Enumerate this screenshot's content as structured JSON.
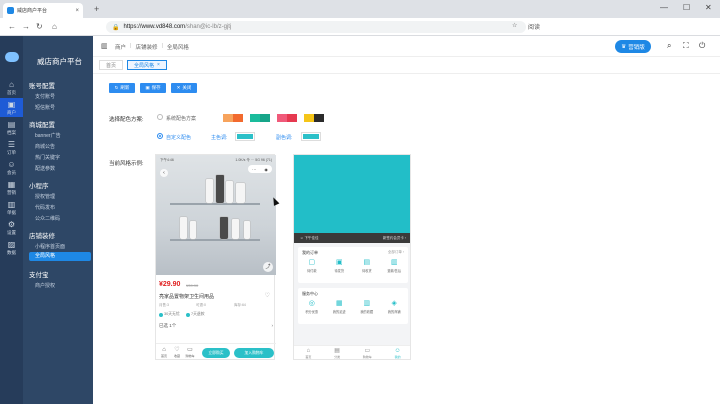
{
  "browser": {
    "tab_title": "威店商户平台",
    "tab_close": "×",
    "new_tab": "+",
    "url_host": "https://www.vd848.com",
    "url_path": "/shan@ic-lb/z-gjtj",
    "reading_mode": "阅读",
    "win_min": "—",
    "win_max": "☐",
    "win_close": "✕"
  },
  "sidebar": {
    "brand": "威店商户平台",
    "rail": [
      {
        "glyph": "⌂",
        "label": "首页"
      },
      {
        "glyph": "▣",
        "label": "商户"
      },
      {
        "glyph": "▤",
        "label": "档案"
      },
      {
        "glyph": "☰",
        "label": "订单"
      },
      {
        "glyph": "☺",
        "label": "会员"
      },
      {
        "glyph": "▦",
        "label": "营销"
      },
      {
        "glyph": "▥",
        "label": "单据"
      },
      {
        "glyph": "⚙",
        "label": "设置"
      },
      {
        "glyph": "▨",
        "label": "数据"
      }
    ],
    "groups": [
      {
        "title": "账号配置",
        "items": [
          "支付账号",
          "短信账号"
        ]
      },
      {
        "title": "商城配置",
        "items": [
          "banner广告",
          "商城公告",
          "热门关键字",
          "配送参数"
        ]
      },
      {
        "title": "小程序",
        "items": [
          "授权管理",
          "代码发布",
          "公众二维码"
        ]
      },
      {
        "title": "店铺装修",
        "items": [
          "小程序首页面",
          "全局风格"
        ]
      },
      {
        "title": "支付宝",
        "items": [
          "商户授权"
        ]
      }
    ]
  },
  "header": {
    "crumbs": [
      "商户",
      "店铺装修",
      "全局风格"
    ],
    "vip_label": "营销版"
  },
  "subtabs": [
    {
      "label": "首页",
      "active": false
    },
    {
      "label": "全局风格",
      "active": true
    }
  ],
  "toolbar": {
    "buttons": [
      "刷新",
      "保存",
      "关闭"
    ]
  },
  "form": {
    "scheme_label": "选择配色方案:",
    "system_scheme": "系统配色方案",
    "custom_scheme": "自定义配色",
    "main_color_label": "主色调:",
    "sub_color_label": "副色调:",
    "preview_label": "当前风格示例:",
    "swatches": [
      {
        "a": "#f7a35c",
        "b": "#f26a2e"
      },
      {
        "a": "#1abc9c",
        "b": "#17a589"
      },
      {
        "a": "#f05a7a",
        "b": "#e63950"
      },
      {
        "a": "#f5c518",
        "b": "#2b2b2b"
      }
    ],
    "main_color": "#2bc0c8",
    "sub_color": "#2bc0c8"
  },
  "preview1": {
    "status_left": "下午4:46",
    "status_right": "1.0K/s 令 ⋯ 5G 96 (71)",
    "price": "¥29.90",
    "orig_price": "¥39.90",
    "name": "亮家品置物架卫生间用品",
    "meta": [
      "月售:3",
      "可退:0",
      "库存:64"
    ],
    "badges": [
      "30天无忧",
      "7天退款"
    ],
    "select_label": "已选  1个",
    "select_arrow": "›",
    "bar_items": [
      {
        "glyph": "⌂",
        "label": "首页"
      },
      {
        "glyph": "♡",
        "label": "收藏"
      },
      {
        "glyph": "▭",
        "label": "购物车"
      }
    ],
    "buy_now": "立即购买",
    "add_cart": "加入购物车"
  },
  "preview2": {
    "strip_left": "☺  下午佳佳",
    "strip_right": "新签约会员卡 ›",
    "orders_title": "我的订单",
    "orders_more": "全部订单 ›",
    "order_items": [
      {
        "glyph": "▢",
        "label": "待付款"
      },
      {
        "glyph": "▣",
        "label": "待发货"
      },
      {
        "glyph": "▤",
        "label": "待收货"
      },
      {
        "glyph": "▥",
        "label": "退款/售后"
      }
    ],
    "service_title": "服务中心",
    "service_items": [
      {
        "glyph": "◎",
        "label": "积分优惠"
      },
      {
        "glyph": "▦",
        "label": "我的足迹"
      },
      {
        "glyph": "▥",
        "label": "我的收藏"
      },
      {
        "glyph": "◈",
        "label": "我的商铺"
      }
    ],
    "tabs": [
      {
        "glyph": "⌂",
        "label": "首页"
      },
      {
        "glyph": "▤",
        "label": "分类"
      },
      {
        "glyph": "▭",
        "label": "购物车"
      },
      {
        "glyph": "☺",
        "label": "我的"
      }
    ]
  }
}
